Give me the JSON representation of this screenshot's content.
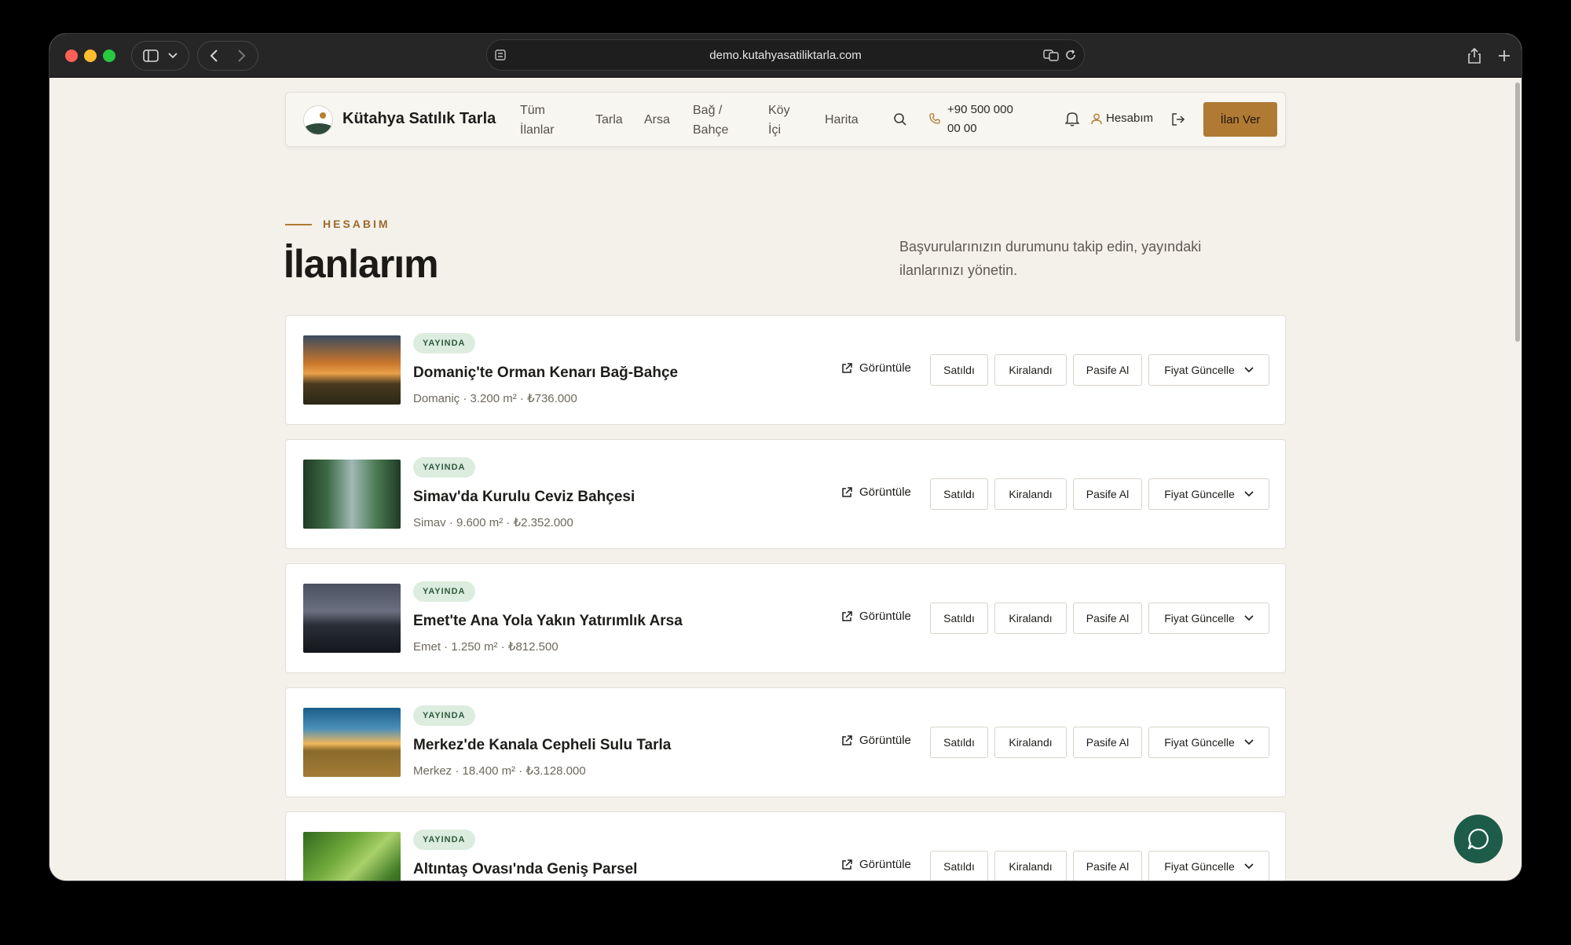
{
  "browser": {
    "url": "demo.kutahyasatiliktarla.com"
  },
  "nav": {
    "brand": "Kütahya Satılık Tarla",
    "links": [
      {
        "line1": "Tüm",
        "line2": "İlanlar"
      },
      {
        "line1": "Tarla",
        "line2": ""
      },
      {
        "line1": "Arsa",
        "line2": ""
      },
      {
        "line1": "Bağ /",
        "line2": "Bahçe"
      },
      {
        "line1": "Köy",
        "line2": "İçi"
      },
      {
        "line1": "Harita",
        "line2": ""
      }
    ],
    "phone_line1": "+90 500 000",
    "phone_line2": "00 00",
    "account": "Hesabım",
    "cta": "İlan Ver"
  },
  "header": {
    "eyebrow": "HESABIM",
    "title": "İlanlarım",
    "subtitle": "Başvurularınızın durumunu takip edin, yayındaki ilanlarınızı yönetin."
  },
  "actions": {
    "view": "Görüntüle",
    "sold": "Satıldı",
    "rented": "Kiralandı",
    "deactivate": "Pasife Al",
    "update_price": "Fiyat Güncelle"
  },
  "listings": [
    {
      "status": "YAYINDA",
      "title": "Domaniç'te Orman Kenarı Bağ-Bahçe",
      "location": "Domaniç",
      "area": "3.200 m²",
      "price": "₺736.000"
    },
    {
      "status": "YAYINDA",
      "title": "Simav'da Kurulu Ceviz Bahçesi",
      "location": "Simav",
      "area": "9.600 m²",
      "price": "₺2.352.000"
    },
    {
      "status": "YAYINDA",
      "title": "Emet'te Ana Yola Yakın Yatırımlık Arsa",
      "location": "Emet",
      "area": "1.250 m²",
      "price": "₺812.500"
    },
    {
      "status": "YAYINDA",
      "title": "Merkez'de Kanala Cepheli Sulu Tarla",
      "location": "Merkez",
      "area": "18.400 m²",
      "price": "₺3.128.000"
    },
    {
      "status": "YAYINDA",
      "title": "Altıntaş Ovası'nda Geniş Parsel",
      "location": "",
      "area": "",
      "price": ""
    }
  ],
  "colors": {
    "accent": "#b07a34",
    "badge_bg": "#dcecdf",
    "chat_button": "#1e5c4a"
  }
}
